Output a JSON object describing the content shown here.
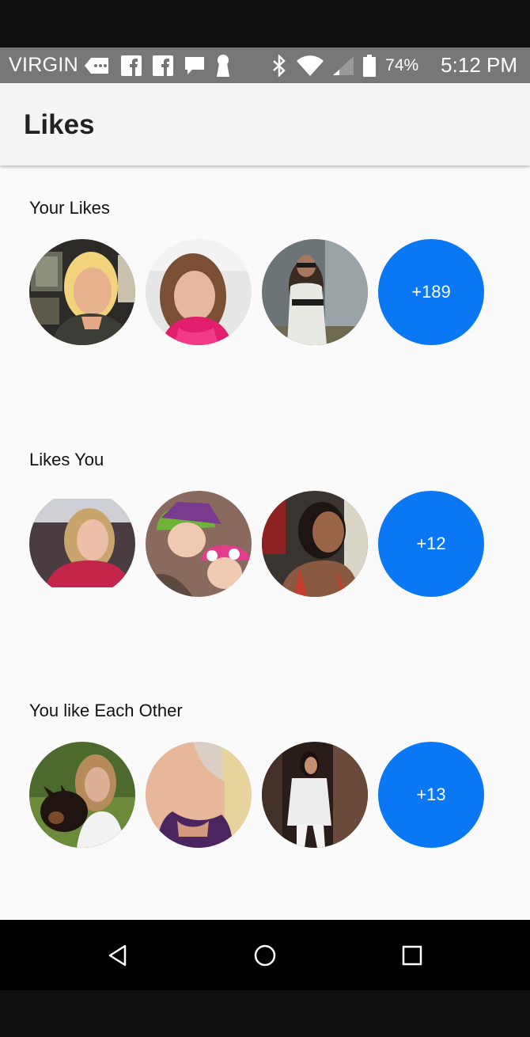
{
  "status_bar": {
    "carrier": "VIRGIN",
    "battery": "74%",
    "time": "5:12 PM"
  },
  "app_bar": {
    "title": "Likes"
  },
  "sections": [
    {
      "title": "Your Likes",
      "more_label": "+189"
    },
    {
      "title": "Likes You",
      "more_label": "+12"
    },
    {
      "title": "You like Each Other",
      "more_label": "+13"
    }
  ],
  "colors": {
    "accent": "#0a78f5",
    "status_bar": "#777777",
    "app_bar": "#f5f5f5",
    "background": "#fafafa"
  }
}
